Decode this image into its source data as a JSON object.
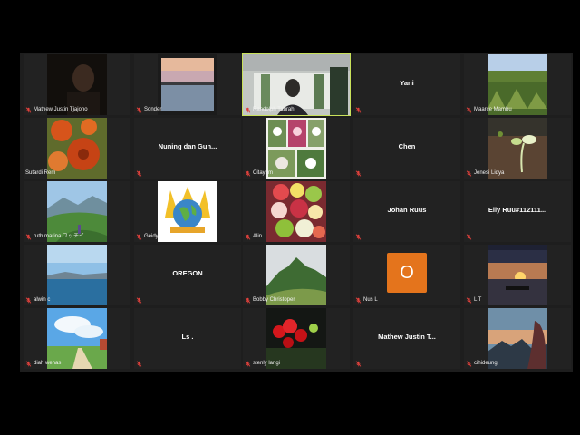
{
  "meeting": {
    "view": "gallery",
    "active_speaker_color": "#c9e15a",
    "mic_muted_color": "#e0413c",
    "avatar_color": "#e4741c"
  },
  "participants": [
    {
      "name": "Mathew Justin Tjajono",
      "muted": true,
      "tile": "photo",
      "thumb": "dark-portrait"
    },
    {
      "name": "Sonder",
      "muted": true,
      "tile": "photo",
      "thumb": "sunset-lake"
    },
    {
      "name": "Randolph Taurah",
      "muted": true,
      "tile": "video",
      "active": true,
      "thumb": "person-window"
    },
    {
      "name": "Yani",
      "muted": true,
      "tile": "name"
    },
    {
      "name": "Maarce Mambu",
      "muted": true,
      "tile": "photo",
      "thumb": "grass-field"
    },
    {
      "name": "Sutardi Rem",
      "muted": false,
      "tile": "photo",
      "thumb": "orange-flowers"
    },
    {
      "name": "Nuning dan Gun...",
      "muted": true,
      "tile": "name"
    },
    {
      "name": "Citayam",
      "muted": true,
      "tile": "photo",
      "thumb": "flower-collage"
    },
    {
      "name": "Chen",
      "muted": true,
      "tile": "name"
    },
    {
      "name": "Jenesi Lidya",
      "muted": true,
      "tile": "photo",
      "thumb": "sprout"
    },
    {
      "name": "ruth marina ユッチイ",
      "muted": true,
      "tile": "photo",
      "thumb": "hill-landscape"
    },
    {
      "name": "Geidy",
      "muted": true,
      "tile": "photo",
      "thumb": "globe-logo"
    },
    {
      "name": "Alin",
      "muted": true,
      "tile": "photo",
      "thumb": "fruit-salad"
    },
    {
      "name": "Johan Ruus",
      "muted": true,
      "tile": "name"
    },
    {
      "name": "Elly Ruu#112111...",
      "muted": true,
      "tile": "name"
    },
    {
      "name": "alwin c",
      "muted": true,
      "tile": "photo",
      "thumb": "sea-sky"
    },
    {
      "name": "OREGON",
      "muted": true,
      "tile": "name"
    },
    {
      "name": "Bobby Christoper",
      "muted": true,
      "tile": "photo",
      "thumb": "mountain"
    },
    {
      "name": "Nus L",
      "muted": true,
      "tile": "avatar",
      "initial": "O"
    },
    {
      "name": "L T",
      "muted": true,
      "tile": "photo",
      "thumb": "boat-sunset"
    },
    {
      "name": "diah wenas",
      "muted": true,
      "tile": "photo",
      "thumb": "cloud-path"
    },
    {
      "name": "Ls .",
      "muted": true,
      "tile": "name"
    },
    {
      "name": "stenly langi",
      "muted": true,
      "tile": "photo",
      "thumb": "red-flowers"
    },
    {
      "name": "Mathew Justin T...",
      "muted": true,
      "tile": "name"
    },
    {
      "name": "cihideung",
      "muted": true,
      "tile": "photo",
      "thumb": "woman-sunset"
    }
  ]
}
